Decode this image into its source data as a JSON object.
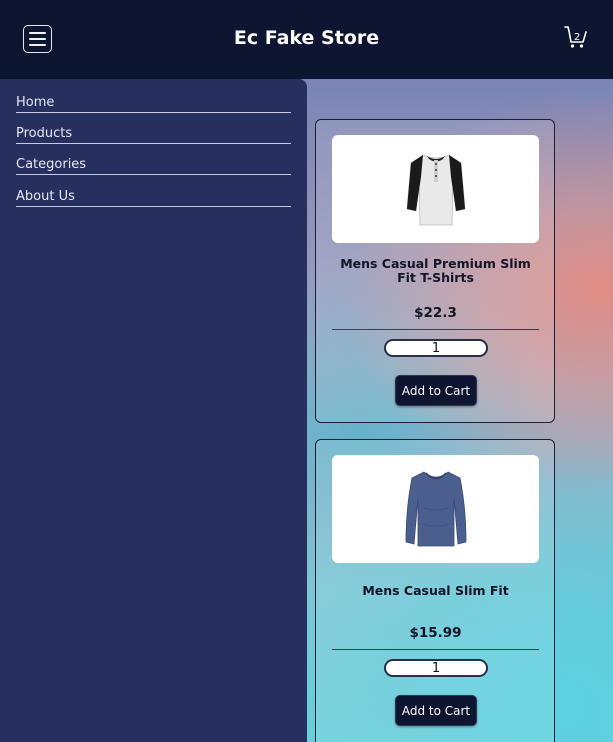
{
  "header": {
    "brand": "Ec Fake Store",
    "cart_count": "2"
  },
  "sidebar": {
    "items": [
      {
        "label": "Home"
      },
      {
        "label": "Products"
      },
      {
        "label": "Categories"
      },
      {
        "label": "About Us"
      }
    ]
  },
  "products": [
    {
      "title": "Mens Casual Premium Slim Fit T-Shirts",
      "price": "$22.3",
      "quantity": "1",
      "button_label": "Add to Cart",
      "image_icon": "henley-shirt-icon"
    },
    {
      "title": "Mens Casual Slim Fit",
      "price": "$15.99",
      "quantity": "1",
      "button_label": "Add to Cart",
      "image_icon": "long-sleeve-shirt-icon"
    }
  ],
  "colors": {
    "header_bg": "#0e1530",
    "sidebar_bg": "#272f5f",
    "button_bg": "#0e1530"
  }
}
